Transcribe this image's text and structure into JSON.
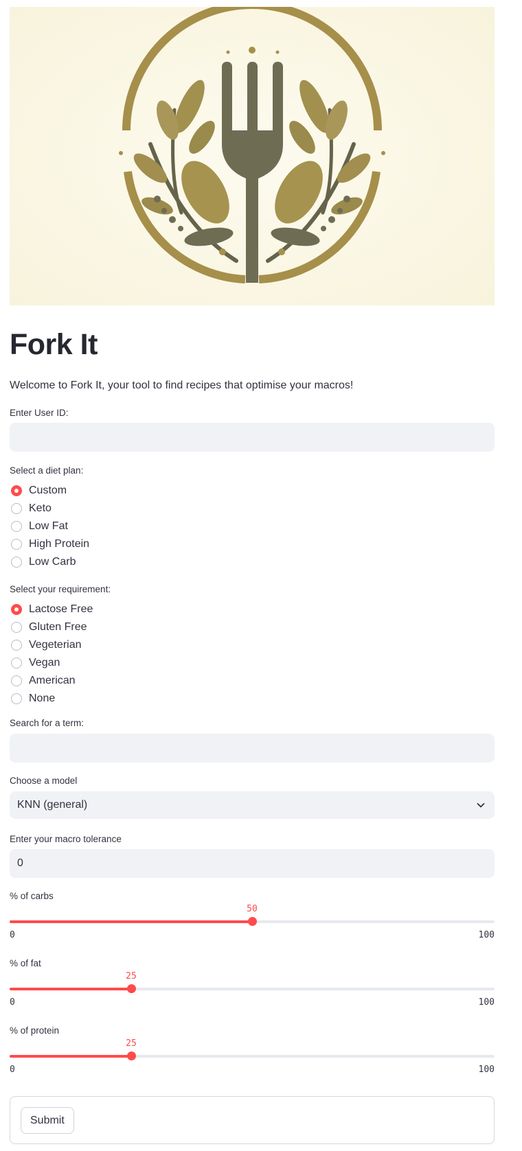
{
  "app": {
    "title": "Fork It",
    "intro": "Welcome to Fork It, your tool to find recipes that optimise your macros!"
  },
  "hero": {
    "description_icon": "fork-and-leaves-logo",
    "colors": {
      "background": "#fbf8e9",
      "gold": "#a6904f",
      "olive": "#6b6a4f"
    }
  },
  "user": {
    "label": "Enter User ID:",
    "value": ""
  },
  "diet": {
    "label": "Select a diet plan:",
    "options": [
      "Custom",
      "Keto",
      "Low Fat",
      "High Protein",
      "Low Carb"
    ],
    "selected": "Custom"
  },
  "requirement": {
    "label": "Select your requirement:",
    "options": [
      "Lactose Free",
      "Gluten Free",
      "Vegeterian",
      "Vegan",
      "American",
      "None"
    ],
    "selected": "Lactose Free"
  },
  "search": {
    "label": "Search for a term:",
    "value": ""
  },
  "model": {
    "label": "Choose a model",
    "value": "KNN (general)"
  },
  "tolerance": {
    "label": "Enter your macro tolerance",
    "value": "0"
  },
  "sliders": {
    "carbs": {
      "label": "% of carbs",
      "value": 50,
      "value_text": "50",
      "min": "0",
      "max": "100"
    },
    "fat": {
      "label": "% of fat",
      "value": 25,
      "value_text": "25",
      "min": "0",
      "max": "100"
    },
    "protein": {
      "label": "% of protein",
      "value": 25,
      "value_text": "25",
      "min": "0",
      "max": "100"
    }
  },
  "form": {
    "submit_label": "Submit"
  },
  "theme": {
    "accent": "#ff4b4b",
    "input_bg": "#f0f2f6",
    "text": "#31333f"
  }
}
